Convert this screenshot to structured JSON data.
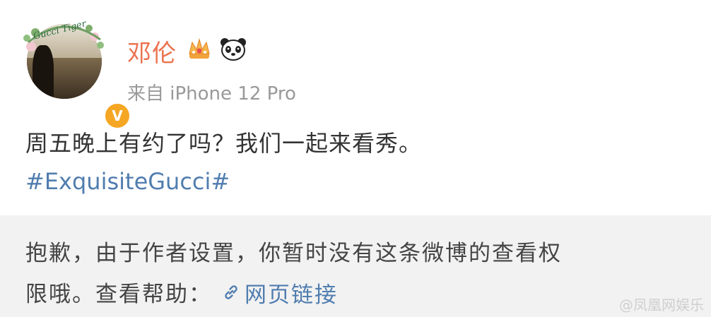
{
  "post": {
    "author": {
      "name": "邓伦",
      "avatar_wreath_text": "Gucci Tiger",
      "verified_badge": "V",
      "icons": [
        "crown-icon",
        "panda-icon"
      ]
    },
    "source": "来自 iPhone 12 Pro",
    "text": "周五晚上有约了吗？我们一起来看秀。",
    "hashtag": "#ExquisiteGucci#"
  },
  "notice": {
    "line1": "抱歉，由于作者设置，你暂时没有这条微博的查看权",
    "line2_prefix": "限哦。查看帮助：",
    "link_label": "网页链接",
    "link_icon": "link-icon"
  },
  "watermark": "@凤凰网娱乐",
  "colors": {
    "username": "#eb7350",
    "link": "#507daf",
    "secondary_text": "#999999",
    "notice_bg": "#f2f2f2",
    "badge": "#f5a623"
  }
}
